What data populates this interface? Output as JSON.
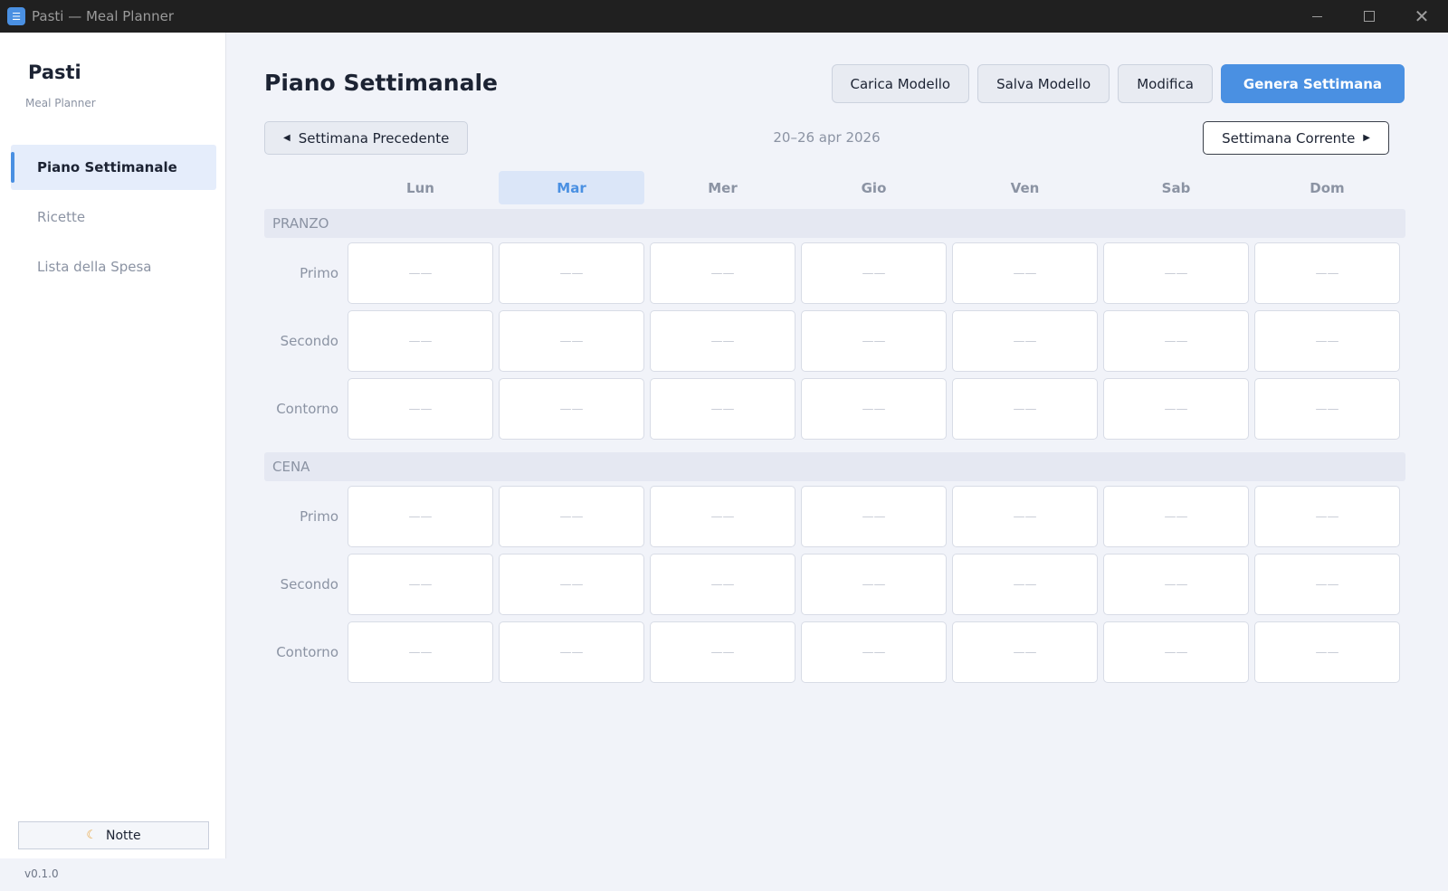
{
  "window": {
    "title": "Pasti — Meal Planner",
    "icon": "fork-knife-icon"
  },
  "sidebar": {
    "brand": "Pasti",
    "subtitle": "Meal Planner",
    "items": [
      {
        "label": "Piano Settimanale",
        "active": true
      },
      {
        "label": "Ricette",
        "active": false
      },
      {
        "label": "Lista della Spesa",
        "active": false
      }
    ],
    "theme_toggle": {
      "icon": "moon-icon",
      "label": "Notte"
    },
    "version": "v0.1.0"
  },
  "main": {
    "title": "Piano Settimanale",
    "toolbar": {
      "load_template": "Carica Modello",
      "save_template": "Salva Modello",
      "edit": "Modifica",
      "generate": "Genera Settimana"
    },
    "week_nav": {
      "prev": "Settimana Precedente",
      "range": "20–26 apr 2026",
      "current": "Settimana Corrente"
    },
    "days": [
      "Lun",
      "Mar",
      "Mer",
      "Gio",
      "Ven",
      "Sab",
      "Dom"
    ],
    "today_index": 1,
    "meals": [
      {
        "name": "PRANZO",
        "courses": [
          "Primo",
          "Secondo",
          "Contorno"
        ]
      },
      {
        "name": "CENA",
        "courses": [
          "Primo",
          "Secondo",
          "Contorno"
        ]
      }
    ],
    "empty_placeholder": "——"
  },
  "colors": {
    "accent": "#4a90e2",
    "background": "#f1f3f9",
    "muted_text": "#8b93a3"
  }
}
